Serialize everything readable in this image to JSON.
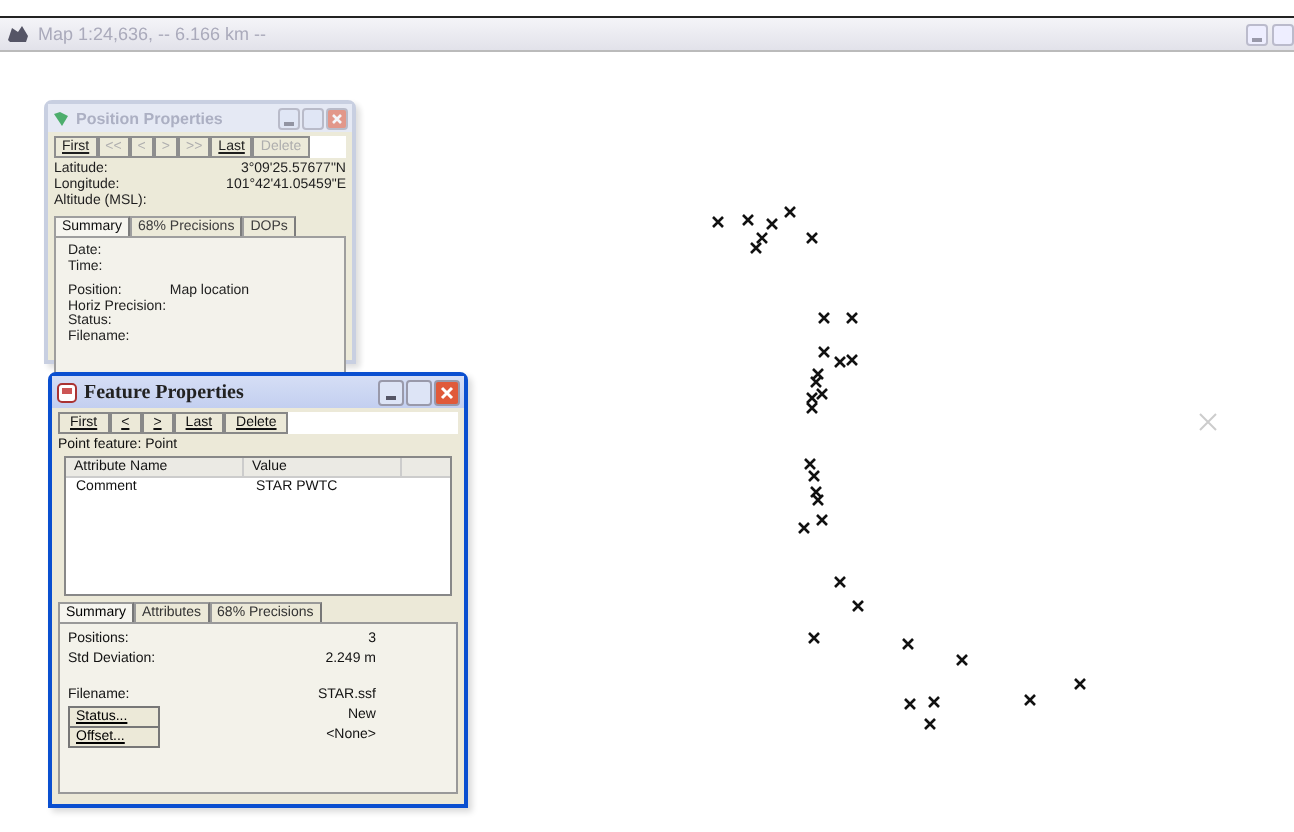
{
  "window": {
    "title": "Map 1:24,636, -- 6.166 km --"
  },
  "position_properties": {
    "title": "Position Properties",
    "active": false,
    "nav_buttons": [
      {
        "label": "First",
        "disabled": false
      },
      {
        "label": "<<",
        "disabled": true
      },
      {
        "label": "<",
        "disabled": true
      },
      {
        "label": ">",
        "disabled": true
      },
      {
        "label": ">>",
        "disabled": true
      },
      {
        "label": "Last",
        "disabled": false
      },
      {
        "label": "Delete",
        "disabled": true
      }
    ],
    "fields": [
      {
        "label": "Latitude:",
        "value": "3°09'25.57677\"N"
      },
      {
        "label": "Longitude:",
        "value": "101°42'41.05459\"E"
      },
      {
        "label": "Altitude (MSL):"
      }
    ],
    "tabs": [
      {
        "label": "Summary",
        "selected": true
      },
      {
        "label": "68% Precisions",
        "selected": false
      },
      {
        "label": "DOPs",
        "selected": false
      }
    ],
    "summary": [
      {
        "label": "Date:"
      },
      {
        "label": "Time:",
        "gap_after": true
      },
      {
        "label": "Position:",
        "value": "Map location"
      },
      {
        "label": "Horiz Precision:"
      },
      {
        "label": "Status:"
      },
      {
        "label": "Filename:"
      }
    ]
  },
  "feature_properties": {
    "title": "Feature Properties",
    "active": true,
    "nav_buttons": [
      {
        "label": "First",
        "disabled": false
      },
      {
        "label": "<",
        "disabled": false
      },
      {
        "label": ">",
        "disabled": false
      },
      {
        "label": "Last",
        "disabled": false
      },
      {
        "label": "Delete",
        "disabled": false
      }
    ],
    "feature_type": "Point feature: Point",
    "table": {
      "columns": [
        "Attribute Name",
        "Value"
      ],
      "rows": [
        [
          "Comment",
          "STAR PWTC"
        ]
      ]
    },
    "tabs": [
      {
        "label": "Summary",
        "selected": true
      },
      {
        "label": "Attributes",
        "selected": false
      },
      {
        "label": "68% Precisions",
        "selected": false
      }
    ],
    "summary": [
      {
        "kind": "text",
        "label": "Positions:",
        "value": "3"
      },
      {
        "kind": "text",
        "label": "Std Deviation:",
        "value": "2.249 m",
        "gap_after": true
      },
      {
        "kind": "text",
        "label": "Filename:",
        "value": "STAR.ssf"
      },
      {
        "kind": "button",
        "label": "Status...",
        "value": "New"
      },
      {
        "kind": "button",
        "label": "Offset...",
        "value": "<None>"
      }
    ]
  }
}
